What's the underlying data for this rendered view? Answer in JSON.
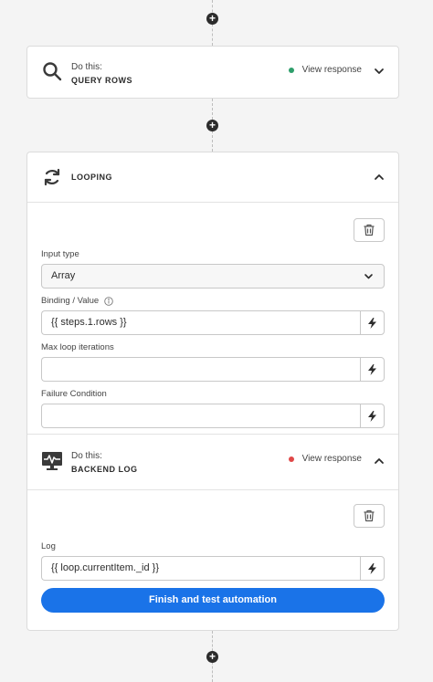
{
  "steps": [
    {
      "id": "query",
      "prefix": "Do this:",
      "title": "QUERY ROWS",
      "view_response": "View response",
      "status_color": "#2e9e6b",
      "icon": "search-icon"
    },
    {
      "id": "looping",
      "title": "LOOPING",
      "icon": "loop-icon",
      "input_type_label": "Input type",
      "input_type_value": "Array",
      "binding_label": "Binding / Value",
      "binding_value": "{{ steps.1.rows }}",
      "max_iterations_label": "Max loop iterations",
      "max_iterations_value": "",
      "failure_label": "Failure Condition",
      "failure_value": ""
    },
    {
      "id": "backend-log",
      "prefix": "Do this:",
      "title": "BACKEND LOG",
      "view_response": "View response",
      "status_color": "#e04848",
      "icon": "monitor-pulse-icon",
      "log_label": "Log",
      "log_value": "{{ loop.currentItem._id }}"
    }
  ],
  "primary_action": "Finish and test automation",
  "add_symbol": "+",
  "colors": {
    "accent": "#1a73e8",
    "success": "#2e9e6b",
    "error": "#e04848"
  }
}
